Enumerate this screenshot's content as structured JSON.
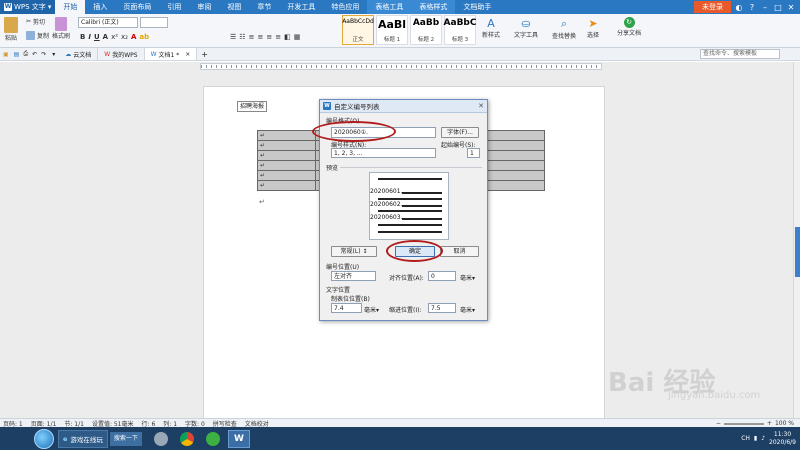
{
  "titlebar": {
    "app_name": "WPS 文字",
    "tabs": [
      "开始",
      "插入",
      "页面布局",
      "引用",
      "审阅",
      "视图",
      "章节",
      "开发工具",
      "特色应用",
      "表格工具",
      "表格样式",
      "文档助手"
    ],
    "active_tab": "开始",
    "login_label": "未登录",
    "close_glyph": "✕"
  },
  "ribbon": {
    "paste_label": "粘贴",
    "cut_label": "剪切",
    "copy_label": "复制",
    "format_painter_label": "格式刷",
    "font_name": "Calibri (正文)",
    "styles": [
      {
        "preview": "AaBbCcDd",
        "label": "正文"
      },
      {
        "preview": "AaBl",
        "label": "标题 1"
      },
      {
        "preview": "AaBb",
        "label": "标题 2"
      },
      {
        "preview": "AaBbC",
        "label": "标题 3"
      }
    ],
    "new_style_label": "新样式",
    "text_tools_label": "文字工具",
    "find_replace_label": "查找替换",
    "select_label": "选择",
    "share_label": "分享文档"
  },
  "quickbar": {
    "doc_tabs": [
      "云文档",
      "我的WPS",
      "文档1 *"
    ],
    "command_search_placeholder": "查找命令、搜索模板"
  },
  "document": {
    "tag_label": "招聘海报",
    "cell_mark": "↵",
    "row_count": 6,
    "para_mark": "↵"
  },
  "dialog": {
    "title": "自定义编号列表",
    "number_format_label": "编号格式(O)",
    "number_format_value": "2020060①.",
    "font_button": "字体(F)...",
    "number_style_label": "编号样式(N):",
    "number_style_value": "1, 2, 3, ...",
    "start_at_label": "起始编号(S):",
    "start_at_value": "1",
    "preview_label": "预览",
    "preview_items": [
      "20200601.",
      "20200602.",
      "20200603."
    ],
    "normal_button": "常规(L) ↕",
    "ok_button": "确定",
    "cancel_button": "取消",
    "number_position_label": "编号位置(U)",
    "alignment_value": "左对齐",
    "align_at_label": "对齐位置(A):",
    "align_at_value": "0",
    "unit_mm": "毫米▾",
    "text_position_label": "文字位置",
    "tab_position_label": "制表位位置(B)",
    "tab_position_value": "7.4",
    "indent_label": "缩进位置(I):",
    "indent_value": "7.5",
    "close_glyph": "✕"
  },
  "statusbar": {
    "page_num": "页码: 1",
    "pages": "页面: 1/1",
    "section": "节: 1/1",
    "position": "设置值: 51毫米",
    "row": "行: 6",
    "column": "列: 1",
    "words": "字数: 0",
    "spell_check": "拼写检查",
    "doc_proof": "文档校对",
    "zoom": "100 %"
  },
  "taskbar": {
    "app_label": "游戏在线玩",
    "search_label": "搜索一下",
    "time": "11:30",
    "date": "2020/6/9",
    "lang": "CH"
  },
  "watermark": {
    "main": "Bai 经验",
    "sub": "jingyan.baidu.com"
  },
  "colors": {
    "title_blue": "#2b78c2",
    "highlight_red": "#b11c1c",
    "login_orange": "#e8592b"
  }
}
